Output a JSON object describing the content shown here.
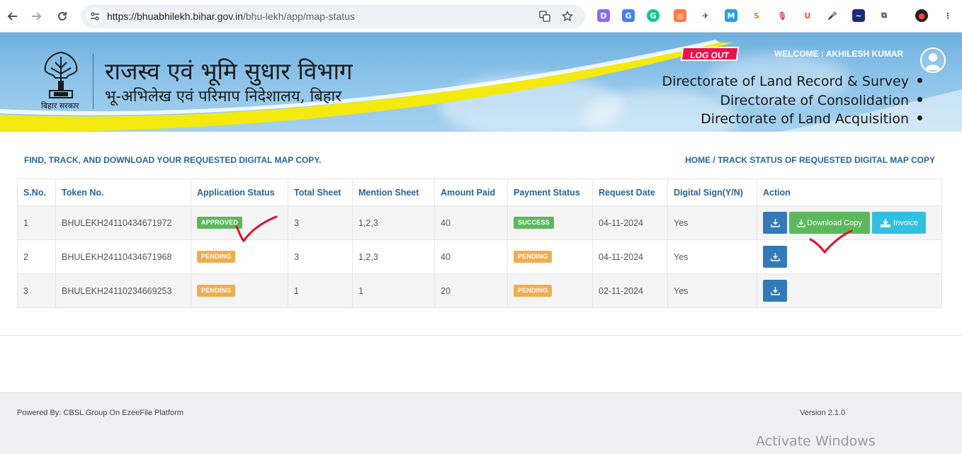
{
  "browser": {
    "url_host": "https://bhuabhilekh.bihar.gov.in",
    "url_path": "/bhu-lekh/app/map-status"
  },
  "header": {
    "dept_title": "राजस्व एवं भूमि सुधार विभाग",
    "dept_subtitle": "भू-अभिलेख एवं परिमाप निदेशालय, बिहार",
    "emblem_caption": "बिहार सरकार",
    "logout_label": "LOG OUT",
    "welcome_text": "WELCOME : AKHILESH KUMAR",
    "directorates": [
      "Directorate of Land Record & Survey",
      "Directorate of Consolidation",
      "Directorate of Land Acquisition"
    ]
  },
  "main": {
    "page_heading": "FIND, TRACK, AND DOWNLOAD YOUR REQUESTED DIGITAL MAP COPY.",
    "breadcrumb": "HOME / TRACK STATUS OF REQUESTED DIGITAL MAP COPY",
    "table": {
      "columns": [
        "S.No.",
        "Token No.",
        "Application Status",
        "Total Sheet",
        "Mention Sheet",
        "Amount Paid",
        "Payment Status",
        "Request Date",
        "Digital Sign(Y/N)",
        "Action"
      ],
      "rows": [
        {
          "sno": "1",
          "token": "BHULEKH24110434671972",
          "app_status": "APPROVED",
          "total_sheet": "3",
          "mention_sheet": "1,2,3",
          "amount": "40",
          "payment_status": "SUCCESS",
          "date": "04-11-2024",
          "digital_sign": "Yes"
        },
        {
          "sno": "2",
          "token": "BHULEKH24110434671968",
          "app_status": "PENDING",
          "total_sheet": "3",
          "mention_sheet": "1,2,3",
          "amount": "40",
          "payment_status": "PENDING",
          "date": "04-11-2024",
          "digital_sign": "Yes"
        },
        {
          "sno": "3",
          "token": "BHULEKH24110234669253",
          "app_status": "PENDING",
          "total_sheet": "1",
          "mention_sheet": "1",
          "amount": "20",
          "payment_status": "PENDING",
          "date": "02-11-2024",
          "digital_sign": "Yes"
        }
      ],
      "action_labels": {
        "download_copy": "Download Copy",
        "invoice": "Invoice"
      }
    }
  },
  "footer": {
    "powered_by": "Powered By: CBSL Group On EzeeFile Platform",
    "version": "Version 2.1.0"
  },
  "overlay": {
    "watermark": "Activate Windows"
  },
  "colors": {
    "primary": "#337ab7",
    "success": "#5cb85c",
    "warning": "#f0ad4e",
    "info": "#31c0e0",
    "logout": "#e8144d",
    "header_blue": "#8cc3ea",
    "heading_text": "#2a6496"
  }
}
